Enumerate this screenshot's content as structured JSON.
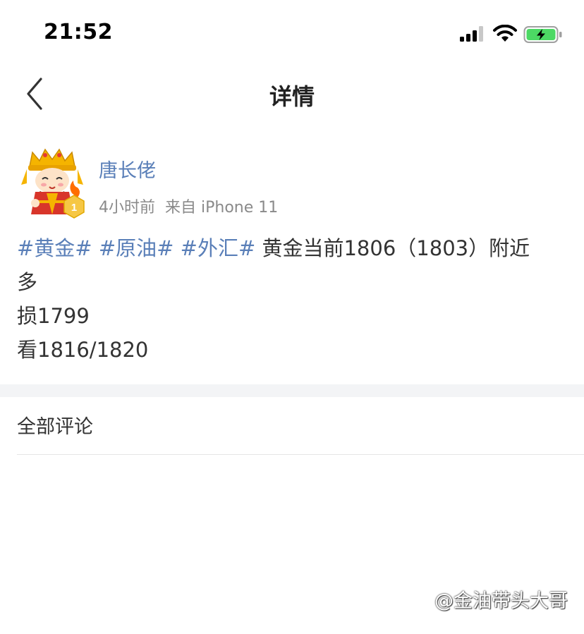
{
  "status_bar": {
    "time": "21:52"
  },
  "nav": {
    "title": "详情"
  },
  "post": {
    "author": "唐长佬",
    "time_ago": "4小时前",
    "source": "来自 iPhone 11",
    "rank": "1",
    "tags": [
      "#黄金#",
      "#原油#",
      "#外汇#"
    ],
    "line1_text": "黄金当前1806（1803）附近",
    "line2": "多",
    "line3": "损1799",
    "line4": "看1816/1820"
  },
  "comments": {
    "header": "全部评论"
  },
  "watermark": {
    "text": "@金油带头大哥"
  },
  "colors": {
    "link": "#5a7fb8",
    "battery": "#4cd964"
  }
}
